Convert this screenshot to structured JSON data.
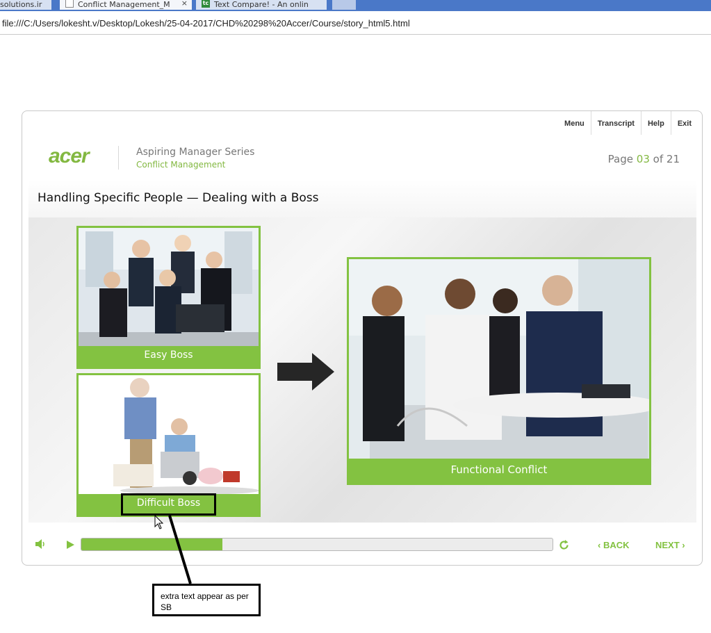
{
  "browser": {
    "tabs": [
      {
        "label": "solutions.ir"
      },
      {
        "label": "Conflict Management_M"
      },
      {
        "label": "Text Compare! - An onlin"
      }
    ],
    "tab_close_glyph": "×",
    "favicon_tc": "tc",
    "url": "file:///C:/Users/lokesht.v/Desktop/Lokesh/25-04-2017/CHD%20298%20Accer/Course/story_html5.html"
  },
  "player": {
    "nav": {
      "menu": "Menu",
      "transcript": "Transcript",
      "help": "Help",
      "exit": "Exit"
    },
    "logo_text": "acer",
    "series": "Aspiring Manager Series",
    "course": "Conflict Management",
    "page": {
      "prefix": "Page",
      "current": "03",
      "separator": "of",
      "total": "21"
    },
    "slide_title": "Handling Specific People — Dealing with a Boss",
    "cards": {
      "easy": "Easy Boss",
      "difficult": "Difficult Boss",
      "functional": "Functional Conflict"
    },
    "controls": {
      "progress": 0.3,
      "back": "‹ BACK",
      "next": "NEXT ›"
    },
    "colors": {
      "accent": "#83c241",
      "logo": "#83b841"
    }
  },
  "annotation": {
    "note": "extra text appear as per SB"
  },
  "icons": [
    "tab-favicon-icon",
    "speaker-icon",
    "play-icon",
    "replay-icon",
    "arrow-right-icon",
    "mouse-cursor-icon"
  ]
}
